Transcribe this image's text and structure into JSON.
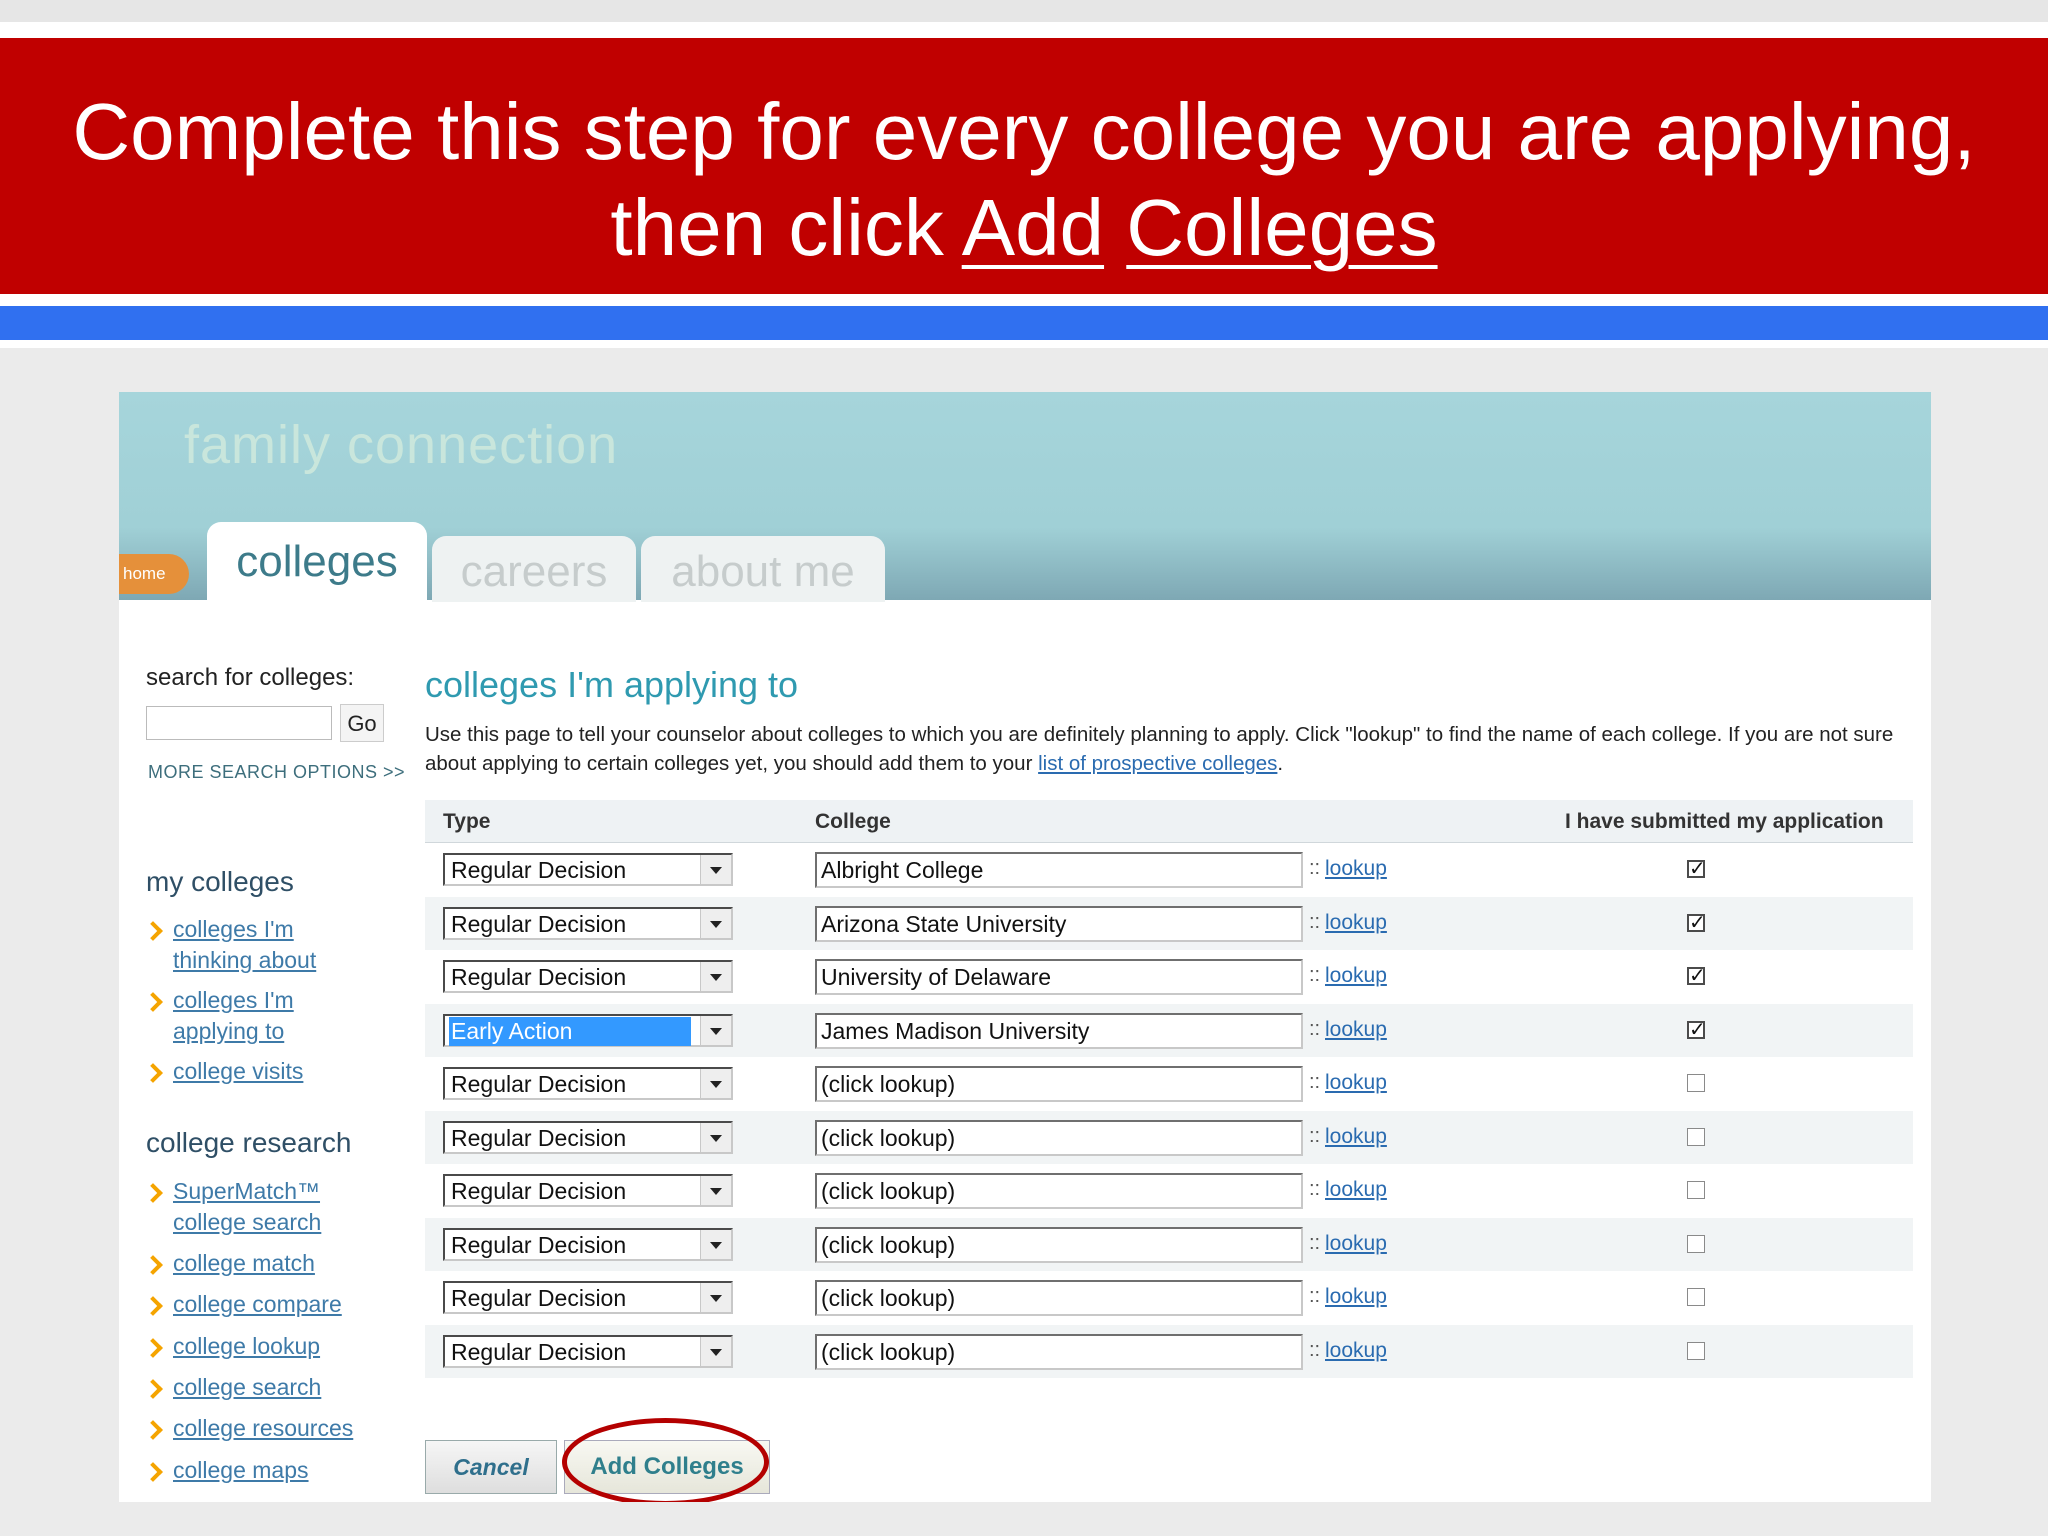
{
  "slide": {
    "heading_line1": "Complete this step for every college you are applying,",
    "heading_line2_prefix": "then click ",
    "heading_link1": "Add",
    "heading_link2": "Colleges",
    "colors": {
      "banner": "#c00000",
      "bar": "#3070f0"
    }
  },
  "site": {
    "brand": "family connection",
    "home_label": "home",
    "tabs": [
      {
        "label": "colleges",
        "active": true
      },
      {
        "label": "careers",
        "active": false
      },
      {
        "label": "about me",
        "active": false
      }
    ]
  },
  "sidebar": {
    "search_label": "search for colleges:",
    "search_value": "",
    "go_label": "Go",
    "more_search": "MORE SEARCH OPTIONS >>",
    "my_colleges_heading": "my colleges",
    "my_colleges": [
      "colleges I'm thinking about",
      "colleges I'm applying to",
      "college visits"
    ],
    "research_heading": "college research",
    "research": [
      "SuperMatch™ college search",
      "college match",
      "college compare",
      "college lookup",
      "college search",
      "college resources",
      "college maps"
    ]
  },
  "main": {
    "title": "colleges I'm applying to",
    "desc": "Use this page to tell your counselor about colleges to which you are definitely planning to apply. Click \"lookup\" to find the name of each college. If you are not sure about applying to certain colleges yet, you should add them to your ",
    "desc_link": "list of prospective colleges",
    "desc_end": ".",
    "columns": {
      "type": "Type",
      "college": "College",
      "submitted": "I have submitted my application"
    },
    "lookup_sep": "::",
    "lookup_label": "lookup",
    "rows": [
      {
        "type": "Regular Decision",
        "college": "Albright College",
        "submitted": true,
        "highlight": false
      },
      {
        "type": "Regular Decision",
        "college": "Arizona State University",
        "submitted": true,
        "highlight": false
      },
      {
        "type": "Regular Decision",
        "college": "University of Delaware",
        "submitted": true,
        "highlight": false
      },
      {
        "type": "Early Action",
        "college": "James Madison University",
        "submitted": true,
        "highlight": true
      },
      {
        "type": "Regular Decision",
        "college": "(click lookup)",
        "submitted": false,
        "highlight": false
      },
      {
        "type": "Regular Decision",
        "college": "(click lookup)",
        "submitted": false,
        "highlight": false
      },
      {
        "type": "Regular Decision",
        "college": "(click lookup)",
        "submitted": false,
        "highlight": false
      },
      {
        "type": "Regular Decision",
        "college": "(click lookup)",
        "submitted": false,
        "highlight": false
      },
      {
        "type": "Regular Decision",
        "college": "(click lookup)",
        "submitted": false,
        "highlight": false
      },
      {
        "type": "Regular Decision",
        "college": "(click lookup)",
        "submitted": false,
        "highlight": false
      }
    ],
    "cancel_label": "Cancel",
    "add_label": "Add Colleges"
  }
}
